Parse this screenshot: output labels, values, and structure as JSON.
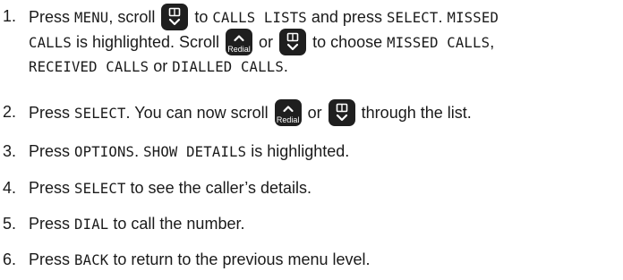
{
  "steps": [
    {
      "number": "1.",
      "line1": {
        "t1": "Press ",
        "c1": "MENU",
        "t2": ", scroll ",
        "t3": " to ",
        "c2": "CALLS LISTS",
        "t4": " and press ",
        "c3": "SELECT",
        "t5": ". ",
        "c4": "MISSED"
      },
      "line2": {
        "c1": "CALLS",
        "t1": " is highlighted. Scroll ",
        "t2": " or ",
        "t3": " to choose ",
        "c2": "MISSED CALLS",
        "t4": ","
      },
      "line3": {
        "c1": "RECEIVED CALLS",
        "t1": " or ",
        "c2": "DIALLED CALLS",
        "t2": "."
      }
    },
    {
      "number": "2.",
      "t1": "Press ",
      "c1": "SELECT",
      "t2": ". You can now scroll ",
      "t3": " or ",
      "t4": " through the list."
    },
    {
      "number": "3.",
      "t1": "Press ",
      "c1": "OPTIONS",
      "t2": ". ",
      "c2": "SHOW DETAILS",
      "t3": " is highlighted."
    },
    {
      "number": "4.",
      "t1": "Press ",
      "c1": "SELECT",
      "t2": " to see the caller’s details."
    },
    {
      "number": "5.",
      "t1": "Press ",
      "c1": "DIAL",
      "t2": " to call the number."
    },
    {
      "number": "6.",
      "t1": "Press ",
      "c1": "BACK",
      "t2": " to return to the previous menu level."
    }
  ],
  "keys": {
    "redial_label": "Redial",
    "down_icon": "phonebook-down-icon",
    "up_icon": "redial-up-icon",
    "key_color": "#1f1f1f"
  }
}
